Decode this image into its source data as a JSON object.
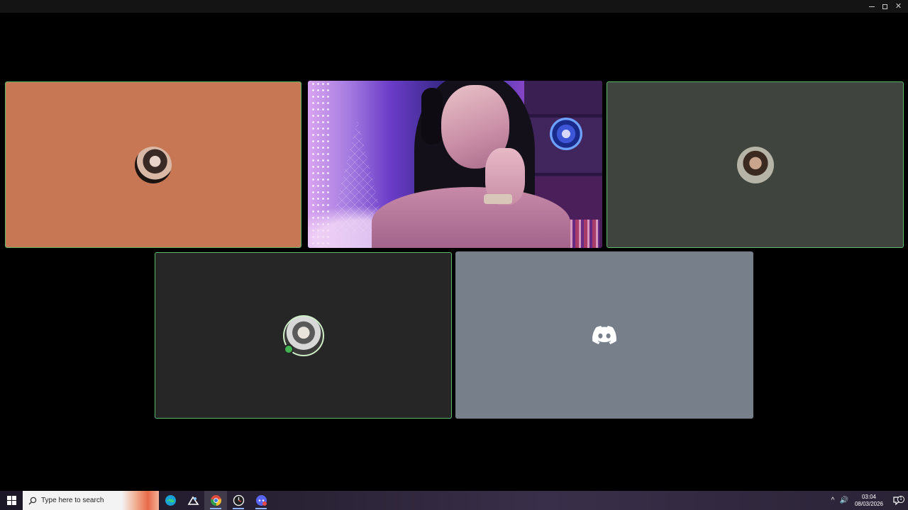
{
  "window": {
    "controls": [
      "minimize",
      "maximize",
      "close"
    ],
    "close_glyph": "✕"
  },
  "call": {
    "tiles": [
      {
        "kind": "avatar",
        "background": "#c87755",
        "speaking": true,
        "avatar": "user-avatar"
      },
      {
        "kind": "video",
        "background": "#2a1a4a",
        "speaking": false,
        "avatar": "camera-feed"
      },
      {
        "kind": "avatar",
        "background": "#40443f",
        "speaking": true,
        "avatar": "user-avatar"
      },
      {
        "kind": "avatar",
        "background": "#262626",
        "speaking": true,
        "avatar": "user-avatar",
        "status": "online"
      },
      {
        "kind": "logo",
        "background": "#777f8b",
        "speaking": false,
        "avatar": "discord-logo-icon"
      }
    ],
    "colors": {
      "speaking_border": "#5bb96a",
      "online_status": "#43b351"
    }
  },
  "taskbar": {
    "search_placeholder": "Type here to search",
    "apps": [
      "windows-start-icon",
      "edge-icon",
      "steam-icon",
      "chrome-icon",
      "clock-app-icon",
      "discord-app-icon"
    ],
    "tray": {
      "chevron": "^",
      "volume": "🔊",
      "time": "03:04",
      "date": "08/03/2026",
      "notifications_count": "1"
    }
  }
}
